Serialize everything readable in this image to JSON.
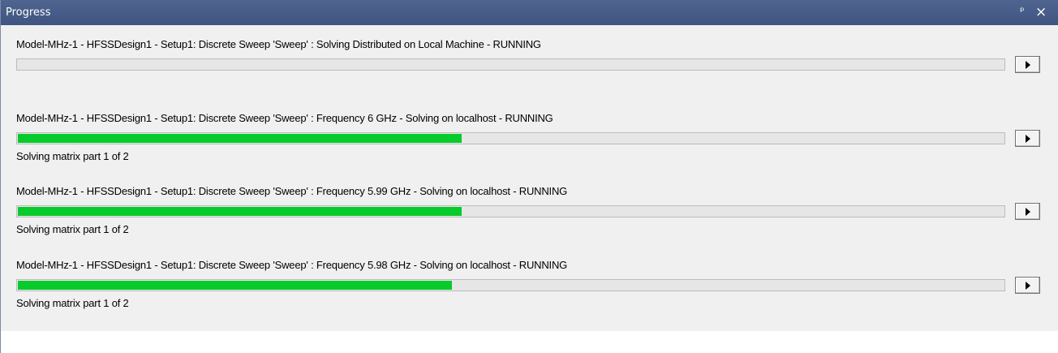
{
  "window": {
    "title": "Progress",
    "pin_glyph": "ᵖ",
    "close_glyph": "×"
  },
  "colors": {
    "titlebar": "#3f5480",
    "progress_fill": "#06cb2b",
    "panel_background": "#f0f0f0"
  },
  "tasks": [
    {
      "label": "Model-MHz-1 - HFSSDesign1 - Setup1: Discrete Sweep 'Sweep' : Solving Distributed on Local Machine - RUNNING",
      "progress": 0,
      "status": "",
      "expand_icon": "play-icon"
    },
    {
      "label": "Model-MHz-1 - HFSSDesign1 - Setup1: Discrete Sweep 'Sweep' : Frequency 6 GHz - Solving on localhost - RUNNING",
      "progress": 0.45,
      "status": "Solving matrix part 1 of 2",
      "expand_icon": "play-icon"
    },
    {
      "label": "Model-MHz-1 - HFSSDesign1 - Setup1: Discrete Sweep 'Sweep' : Frequency 5.99 GHz - Solving on localhost - RUNNING",
      "progress": 0.45,
      "status": "Solving matrix part 1 of 2",
      "expand_icon": "play-icon"
    },
    {
      "label": "Model-MHz-1 - HFSSDesign1 - Setup1: Discrete Sweep 'Sweep' : Frequency 5.98 GHz - Solving on localhost - RUNNING",
      "progress": 0.44,
      "status": "Solving matrix part 1 of 2",
      "expand_icon": "play-icon"
    }
  ]
}
